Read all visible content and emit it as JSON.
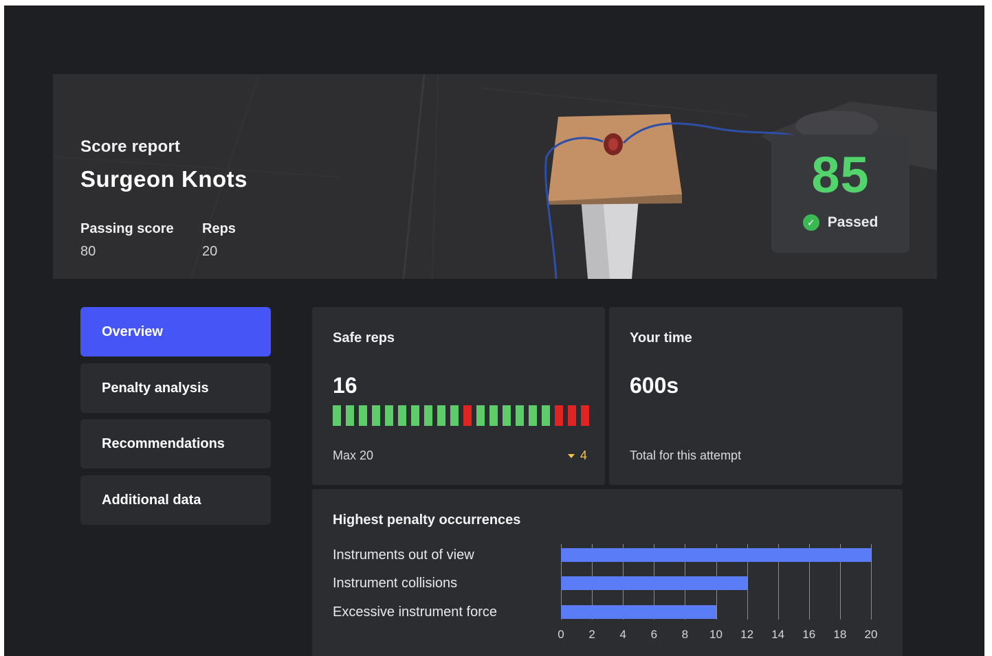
{
  "header": {
    "label": "Score report",
    "title": "Surgeon Knots",
    "passing_score_label": "Passing score",
    "passing_score": "80",
    "reps_label": "Reps",
    "reps": "20",
    "score": "85",
    "status": "Passed",
    "status_icon": "check-icon"
  },
  "nav": {
    "items": [
      {
        "label": "Overview",
        "active": true
      },
      {
        "label": "Penalty analysis",
        "active": false
      },
      {
        "label": "Recommendations",
        "active": false
      },
      {
        "label": "Additional data",
        "active": false
      }
    ]
  },
  "safe_reps": {
    "title": "Safe reps",
    "value": "16",
    "reps": [
      1,
      1,
      1,
      1,
      1,
      1,
      1,
      1,
      1,
      1,
      0,
      1,
      1,
      1,
      1,
      1,
      1,
      0,
      0,
      0
    ],
    "max_label": "Max 20",
    "unsafe_count": "4"
  },
  "time": {
    "title": "Your time",
    "value": "600s",
    "caption": "Total for this attempt"
  },
  "penalties": {
    "title": "Highest penalty occurrences",
    "items": [
      {
        "label": "Instruments out of view",
        "value": 20
      },
      {
        "label": "Instrument collisions",
        "value": 12
      },
      {
        "label": "Excessive instrument force",
        "value": 10
      }
    ],
    "ticks": [
      "0",
      "2",
      "4",
      "6",
      "8",
      "10",
      "12",
      "14",
      "16",
      "18",
      "20"
    ],
    "xmax": 20
  },
  "colors": {
    "accent": "#4655f5",
    "score_green": "#52d36b",
    "safe": "#5fcc6c",
    "unsafe": "#e02424",
    "warning": "#f4c34a",
    "bar": "#5b7cf7"
  }
}
